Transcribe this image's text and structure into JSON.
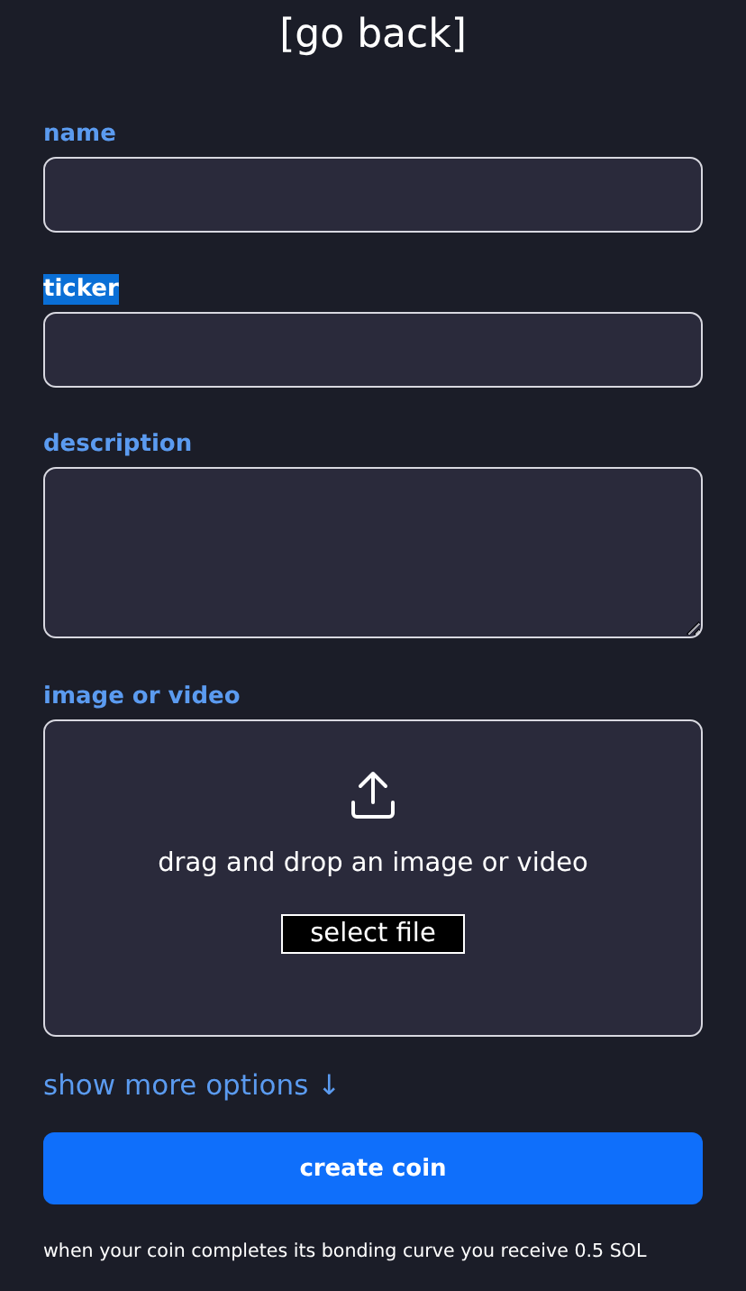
{
  "back_link": "[go back]",
  "fields": [
    {
      "kind": "input",
      "label": "name",
      "highlighted": false
    },
    {
      "kind": "input",
      "label": "ticker",
      "highlighted": true
    },
    {
      "kind": "textarea",
      "label": "description",
      "highlighted": false
    },
    {
      "kind": "upload",
      "label": "image or video",
      "highlighted": false,
      "hint": "drag and drop an image or video",
      "button": "select file"
    }
  ],
  "more_options": "show more options ↓",
  "submit": "create coin",
  "note": "when your coin completes its bonding curve you receive 0.5 SOL"
}
